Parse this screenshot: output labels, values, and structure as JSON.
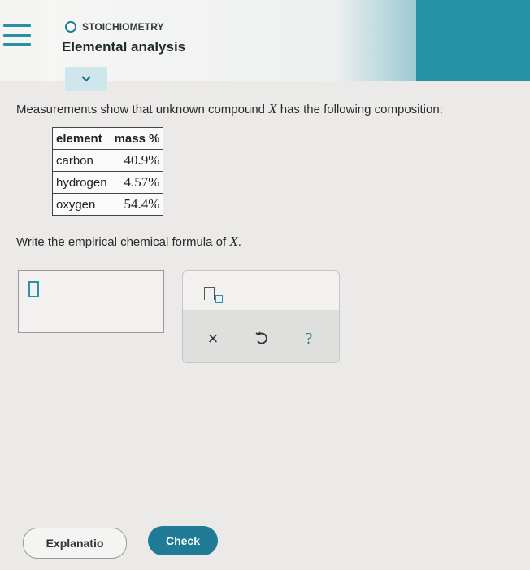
{
  "header": {
    "topic": "STOICHIOMETRY",
    "title": "Elemental analysis"
  },
  "question": {
    "text_before": "Measurements show that unknown compound ",
    "variable": "X",
    "text_after": " has the following composition:"
  },
  "table": {
    "headers": [
      "element",
      "mass %"
    ],
    "rows": [
      {
        "element": "carbon",
        "mass": "40.9%"
      },
      {
        "element": "hydrogen",
        "mass": "4.57%"
      },
      {
        "element": "oxygen",
        "mass": "54.4%"
      }
    ]
  },
  "prompt": {
    "text_before": "Write the empirical chemical formula of ",
    "variable": "X",
    "text_after": "."
  },
  "palette": {
    "clear_symbol": "×",
    "help_symbol": "?"
  },
  "buttons": {
    "explanation": "Explanatio",
    "check": "Check"
  },
  "colors": {
    "accent": "#1f7b96",
    "header_teal": "#2592a8",
    "cursor": "#2b8fb0"
  }
}
